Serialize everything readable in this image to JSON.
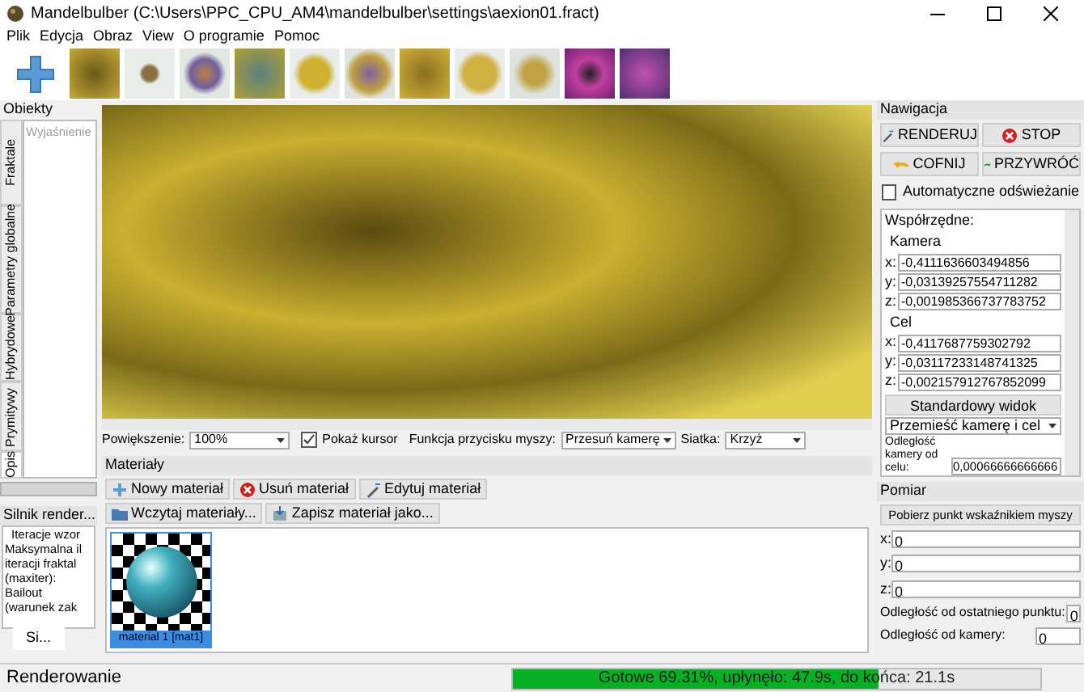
{
  "window": {
    "title": "Mandelbulber (C:\\Users\\PPC_CPU_AM4\\mandelbulber\\settings\\aexion01.fract)"
  },
  "menu": [
    "Plik",
    "Edycja",
    "Obraz",
    "View",
    "O programie",
    "Pomoc"
  ],
  "objects_panel": {
    "title": "Obiekty",
    "placeholder": "Wyjaśnienie",
    "tabs": [
      {
        "label": "Fraktale",
        "selected": false
      },
      {
        "label": "Parametry globalne",
        "selected": false
      },
      {
        "label": "Hybrydowe",
        "selected": false
      },
      {
        "label": "Prymitywy",
        "selected": false
      },
      {
        "label": "Opis",
        "selected": true
      }
    ]
  },
  "engine_panel": {
    "title": "Silnik render...",
    "heading": "Iteracje wzor",
    "lines": [
      "Maksymalna il",
      "iteracji fraktal",
      "(maxiter):",
      "Bailout",
      "(warunek zak"
    ],
    "tab": "Si..."
  },
  "render_toolbar": {
    "zoom_label": "Powiększenie:",
    "zoom_value": "100%",
    "show_cursor": {
      "label": "Pokaż kursor",
      "checked": true
    },
    "mouse_label": "Funkcja przycisku myszy:",
    "mouse_value": "Przesuń kamerę",
    "grid_label": "Siatka:",
    "grid_value": "Krzyż"
  },
  "materials": {
    "title": "Materiały",
    "buttons": [
      {
        "label": "Nowy materiał",
        "kind": "new"
      },
      {
        "label": "Usuń materiał",
        "kind": "delete"
      },
      {
        "label": "Edytuj materiał",
        "kind": "edit"
      }
    ],
    "file_buttons": [
      {
        "label": "Wczytaj materiały...",
        "kind": "load"
      },
      {
        "label": "Zapisz materiał jako...",
        "kind": "save"
      }
    ],
    "items": [
      {
        "label": "material 1 [mat1]",
        "selected": true
      }
    ]
  },
  "navigation": {
    "title": "Nawigacja",
    "buttons": [
      {
        "label": "RENDERUJ",
        "kind": "render"
      },
      {
        "label": "STOP",
        "kind": "stop"
      },
      {
        "label": "COFNIJ",
        "kind": "undo"
      },
      {
        "label": "PRZYWRÓĆ",
        "kind": "redo"
      }
    ],
    "auto_refresh": {
      "label": "Automatyczne odświeżanie",
      "checked": false
    },
    "coords_label": "Współrzędne:",
    "groups": [
      {
        "label": "Kamera",
        "fields": [
          {
            "label": "x:",
            "value": "-0,4111636603494856"
          },
          {
            "label": "y:",
            "value": "-0,03139257554711282"
          },
          {
            "label": "z:",
            "value": "-0,001985366737783752"
          }
        ]
      },
      {
        "label": "Cel",
        "fields": [
          {
            "label": "x:",
            "value": "-0,4117687759302792"
          },
          {
            "label": "y:",
            "value": "-0,03117233148741325"
          },
          {
            "label": "z:",
            "value": "-0,002157912767852099"
          }
        ]
      }
    ],
    "standard_view": "Standardowy widok",
    "move_mode": "Przemieść kamerę i cel",
    "distance_label": "Odległość kamery od celu:",
    "distance_value": "0,00066666666666"
  },
  "measure": {
    "title": "Pomiar",
    "pick_button": "Pobierz punkt wskaźnikiem myszy",
    "fields": [
      {
        "label": "x:",
        "value": "0"
      },
      {
        "label": "y:",
        "value": "0"
      },
      {
        "label": "z:",
        "value": "0"
      }
    ],
    "distances": [
      {
        "label": "Odległość od ostatniego punktu:",
        "value": "0"
      },
      {
        "label": "Odległość od kamery:",
        "value": "0"
      }
    ]
  },
  "status_bar": {
    "text": "Renderowanie",
    "progress": {
      "level": 0.6931,
      "text": "Gotowe 69.31%, upłynęło: 47.9s, do końca: 21.1s"
    }
  }
}
